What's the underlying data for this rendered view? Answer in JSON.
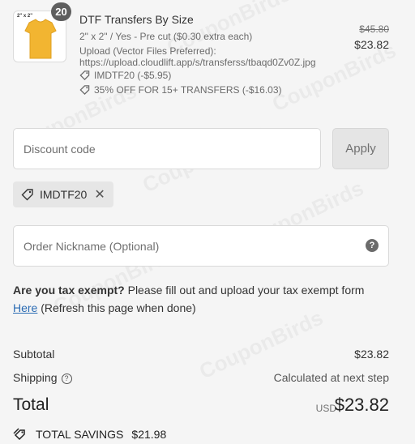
{
  "product": {
    "quantity": "20",
    "title": "DTF Transfers By Size",
    "variant": "2\" x 2\" / Yes - Pre cut ($0.30 extra each)",
    "upload_label": "Upload (Vector Files Preferred):",
    "upload_url": "https://upload.cloudlift.app/s/transferss/tbaqd0Zv0Z.jpg",
    "discounts": [
      "IMDTF20 (-$5.95)",
      "35% OFF FOR 15+ TRANSFERS (-$16.03)"
    ],
    "price_original": "$45.80",
    "price_final": "$23.82",
    "thumb_label": "2\" x 2\""
  },
  "discount": {
    "placeholder": "Discount code",
    "apply_label": "Apply",
    "applied_code": "IMDTF20"
  },
  "nickname": {
    "placeholder": "Order Nickname (Optional)"
  },
  "tax": {
    "question": "Are you tax exempt?",
    "instruction": " Please fill out and upload your tax exempt form ",
    "link": "Here",
    "note": " (Refresh this page when done)"
  },
  "summary": {
    "subtotal_label": "Subtotal",
    "subtotal_value": "$23.82",
    "shipping_label": "Shipping",
    "shipping_value": "Calculated at next step",
    "total_label": "Total",
    "currency": "USD",
    "total_value": "$23.82",
    "savings_label": "TOTAL SAVINGS",
    "savings_value": "$21.98"
  },
  "watermark": "CouponBirds",
  "colors": {
    "background": "#f5f5f5",
    "link": "#2a6bb3",
    "shirt": "#f2b531",
    "badge": "#5f5f5f"
  }
}
